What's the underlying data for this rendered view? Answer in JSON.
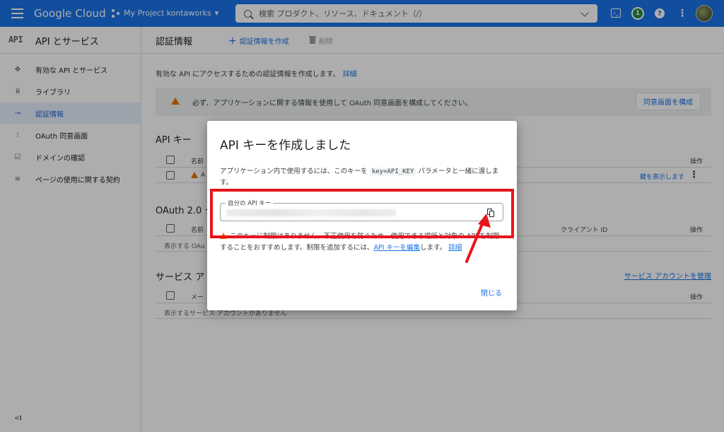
{
  "topbar": {
    "logo": "Google Cloud",
    "project": "My Project kontaworks",
    "search_placeholder": "検索 プロダクト、リソース、ドキュメント（/）",
    "badge_count": "1"
  },
  "sidebar": {
    "logo_text": "API",
    "title": "API とサービス",
    "items": [
      {
        "label": "有効な API とサービス",
        "icon": "hub-icon"
      },
      {
        "label": "ライブラリ",
        "icon": "library-icon"
      },
      {
        "label": "認証情報",
        "icon": "key-icon"
      },
      {
        "label": "OAuth 同意画面",
        "icon": "consent-icon"
      },
      {
        "label": "ドメインの確認",
        "icon": "checkbox-icon"
      },
      {
        "label": "ページの使用に関する契約",
        "icon": "settings-list-icon"
      }
    ],
    "active_index": 2
  },
  "main": {
    "title": "認証情報",
    "create_label": "認証情報を作成",
    "delete_label": "削除",
    "intro": "有効な API にアクセスするための認証情報を作成します。",
    "intro_link": "詳細",
    "warning_text": "必ず、アプリケーションに関する情報を使用して OAuth 同意画面を構成してください。",
    "consent_button": "同意画面を構成",
    "api_keys": {
      "title": "API キー",
      "col_name": "名前",
      "col_actions": "操作",
      "row_prefix": "A",
      "show_key": "鍵を表示します"
    },
    "oauth": {
      "title": "OAuth 2.0 ク",
      "col_name": "名前",
      "col_client": "クライアント ID",
      "col_actions": "操作",
      "empty": "表示する OAu"
    },
    "service": {
      "title": "サービス ア",
      "col_name": "メー",
      "col_actions": "操作",
      "empty": "表示するサービス アカウントがありません",
      "manage": "サービス アカウントを管理"
    }
  },
  "dialog": {
    "title": "API キーを作成しました",
    "desc_before": "アプリケーション内で使用するには、このキーを ",
    "desc_code": "key=API_KEY",
    "desc_after": " パラメータと一緒に渡します。",
    "field_label": "自分の API キー",
    "warn_before": "このキーに制限はありません。不正使用を防ぐため、使用できる場所と対象の API を制限することをおすすめします。制限を追加するには、",
    "warn_link": "API キーを編集",
    "warn_after": "します。",
    "warn_more": "詳細",
    "close": "閉じる"
  },
  "colors": {
    "brand_blue": "#1a73e8",
    "warning_orange": "#e37400",
    "annotation_red": "#e8141a"
  }
}
